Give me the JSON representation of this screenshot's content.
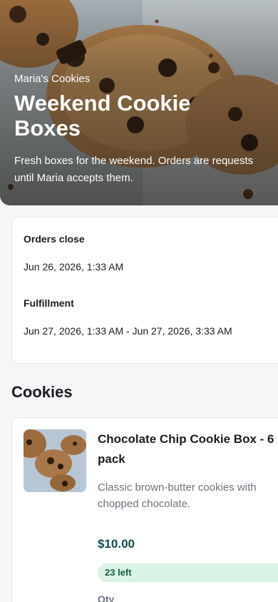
{
  "hero": {
    "brand": "Maria's Cookies",
    "title": "Weekend Cookie Boxes",
    "subtitle": "Fresh boxes for the weekend. Orders are requests until Maria accepts them."
  },
  "schedule": {
    "orders_close_label": "Orders close",
    "orders_close_value": "Jun 26, 2026, 1:33 AM",
    "fulfillment_label": "Fulfillment",
    "fulfillment_value": "Jun 27, 2026, 1:33 AM - Jun 27, 2026, 3:33 AM"
  },
  "section": {
    "title": "Cookies"
  },
  "products": [
    {
      "name": "Chocolate Chip Cookie Box - 6 pack",
      "description": "Classic brown-butter cookies with chopped chocolate.",
      "price": "$10.00",
      "stock": "23 left",
      "qty_label": "Qty"
    }
  ],
  "colors": {
    "page_bg": "#f4f6f8",
    "price": "#0f4f4b",
    "badge_bg": "#d9f3e5",
    "badge_text": "#1b5e3d"
  }
}
